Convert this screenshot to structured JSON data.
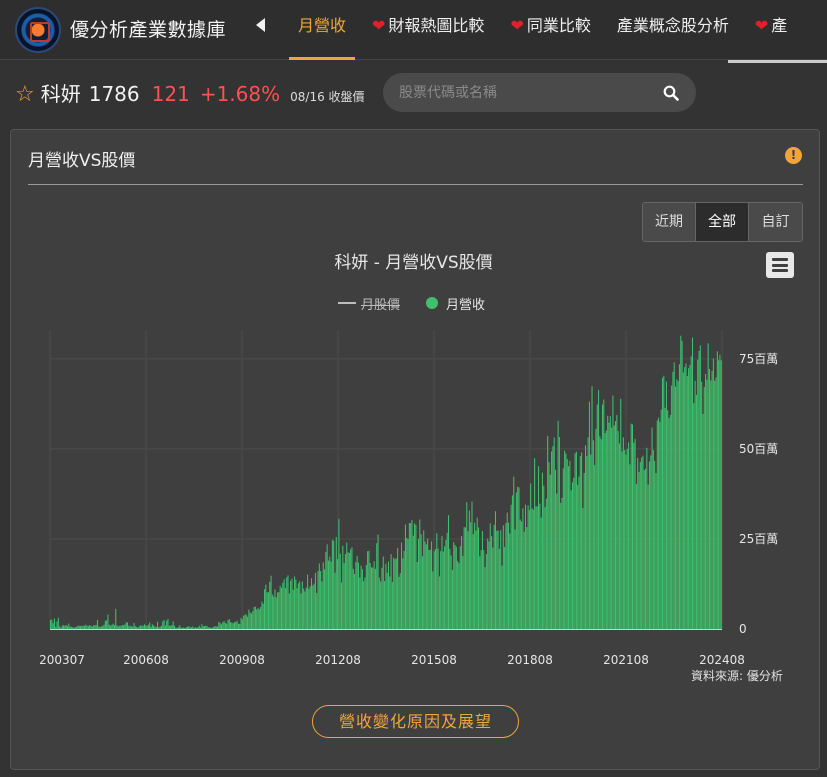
{
  "site": {
    "name": "優分析產業數據庫"
  },
  "nav": {
    "items": [
      {
        "label": "月營收",
        "heart": false,
        "active": true
      },
      {
        "label": "財報熱圖比較",
        "heart": true,
        "active": false
      },
      {
        "label": "同業比較",
        "heart": true,
        "active": false
      },
      {
        "label": "產業概念股分析",
        "heart": false,
        "active": false
      },
      {
        "label": "產",
        "heart": true,
        "active": false
      }
    ]
  },
  "quote": {
    "name": "科妍",
    "code": "1786",
    "price": "121",
    "change": "+1.68%",
    "date": "08/16 收盤價"
  },
  "search": {
    "placeholder": "股票代碼或名稱"
  },
  "card": {
    "title": "月營收VS股價"
  },
  "range": {
    "buttons": [
      "近期",
      "全部",
      "自訂"
    ],
    "selected": "全部"
  },
  "chart_data": {
    "type": "bar",
    "title": "科妍 - 月營收VS股價",
    "legend": [
      {
        "name": "月股價",
        "hidden": true
      },
      {
        "name": "月營收",
        "color": "#3ec06c"
      }
    ],
    "x_tick_labels": [
      "200307",
      "200608",
      "200908",
      "201208",
      "201508",
      "201808",
      "202108",
      "202408"
    ],
    "y_tick_labels": [
      "0",
      "25百萬",
      "50百萬",
      "75百萬"
    ],
    "ylim": [
      0,
      83
    ],
    "y_unit": "百萬",
    "x_start": "200307",
    "x_end": "202408",
    "values": [
      2.5,
      2.6,
      1.6,
      2.9,
      0.6,
      2.1,
      3.1,
      0.7,
      0.4,
      1.0,
      1.0,
      0.9,
      1.1,
      0.8,
      1.5,
      0.7,
      0.6,
      0.5,
      0.4,
      0.5,
      0.6,
      0.9,
      0.9,
      0.8,
      0.9,
      0.9,
      0.9,
      1.2,
      0.9,
      0.8,
      1.1,
      0.9,
      0.7,
      1.0,
      1.1,
      1.1,
      2.5,
      0.7,
      0.6,
      0.7,
      0.9,
      1.2,
      2.3,
      2.4,
      4.0,
      1.2,
      0.9,
      1.2,
      1.5,
      1.1,
      5.6,
      1.0,
      0.7,
      0.9,
      0.9,
      1.1,
      1.0,
      1.3,
      1.9,
      1.8,
      0.9,
      0.9,
      0.7,
      0.7,
      1.7,
      0.8,
      0.6,
      0.4,
      0.8,
      1.0,
      0.9,
      0.9,
      1.3,
      1.0,
      0.9,
      1.2,
      1.8,
      0.6,
      1.3,
      1.0,
      0.7,
      0.6,
      2.0,
      0.5,
      0.7,
      0.9,
      2.1,
      2.5,
      1.0,
      2.3,
      2.8,
      0.9,
      0.9,
      1.1,
      2.1,
      0.9,
      0.4,
      0.3,
      0.6,
      1.0,
      0.4,
      0.3,
      0.4,
      0.3,
      0.5,
      0.6,
      0.8,
      0.4,
      0.5,
      0.7,
      0.3,
      0.5,
      0.3,
      0.5,
      0.9,
      0.4,
      1.3,
      0.8,
      0.8,
      0.9,
      0.8,
      0.4,
      0.5,
      0.3,
      0.4,
      0.6,
      0.8,
      0.7,
      0.7,
      2.0,
      1.7,
      1.3,
      1.9,
      2.2,
      1.7,
      1.5,
      2.5,
      2.8,
      1.9,
      1.8,
      1.6,
      1.9,
      2.0,
      2.3,
      1.5,
      1.4,
      3.1,
      2.7,
      3.7,
      4.0,
      4.0,
      3.4,
      5.4,
      4.6,
      4.3,
      5.0,
      6.1,
      6.2,
      5.4,
      5.8,
      5.5,
      6.1,
      7.6,
      7.0,
      11.0,
      12.3,
      10.2,
      10.2,
      13.1,
      14.8,
      9.6,
      9.0,
      11.0,
      8.8,
      10.2,
      10.2,
      12.0,
      11.4,
      12.8,
      13.8,
      11.4,
      14.3,
      14.9,
      9.9,
      13.4,
      14.0,
      10.9,
      14.6,
      13.7,
      11.3,
      12.7,
      13.2,
      9.9,
      13.2,
      11.2,
      10.4,
      11.5,
      15.1,
      11.2,
      11.9,
      14.1,
      12.1,
      12.6,
      15.6,
      10.0,
      16.1,
      18.2,
      16.1,
      13.2,
      18.5,
      16.5,
      21.4,
      23.5,
      19.0,
      20.1,
      18.7,
      24.7,
      24.5,
      15.6,
      25.5,
      19.4,
      30.6,
      20.9,
      12.9,
      23.1,
      18.3,
      20.8,
      24.0,
      21.3,
      21.1,
      22.1,
      22.7,
      16.7,
      15.3,
      18.6,
      20.3,
      18.4,
      14.3,
      17.6,
      16.6,
      13.3,
      14.3,
      17.8,
      21.6,
      21.7,
      18.3,
      17.1,
      17.1,
      18.8,
      16.7,
      23.8,
      26.2,
      14.3,
      13.2,
      17.0,
      20.1,
      13.3,
      18.1,
      15.6,
      18.7,
      14.6,
      20.8,
      13.1,
      19.8,
      19.4,
      19.6,
      22.5,
      14.5,
      15.5,
      24.0,
      19.6,
      21.7,
      29.0,
      25.3,
      25.0,
      29.4,
      29.4,
      30.2,
      25.9,
      29.3,
      28.9,
      18.6,
      25.0,
      30.4,
      26.3,
      20.2,
      27.4,
      24.3,
      23.5,
      25.1,
      21.9,
      22.0,
      24.3,
      16.0,
      21.6,
      22.2,
      26.6,
      22.3,
      14.6,
      21.6,
      25.8,
      21.5,
      22.9,
      24.7,
      26.7,
      31.6,
      22.3,
      20.4,
      16.4,
      24.1,
      23.3,
      22.8,
      18.9,
      18.3,
      23.0,
      25.8,
      20.3,
      28.3,
      28.2,
      35.2,
      27.2,
      32.9,
      29.6,
      35.4,
      26.3,
      29.5,
      27.3,
      30.9,
      28.2,
      20.2,
      21.9,
      27.2,
      21.9,
      17.2,
      20.8,
      25.1,
      24.3,
      29.3,
      25.8,
      22.6,
      28.9,
      32.7,
      27.2,
      27.4,
      22.3,
      27.4,
      17.6,
      28.8,
      22.8,
      29.4,
      32.3,
      29.5,
      26.5,
      34.5,
      37.1,
      42.3,
      27.6,
      37.9,
      39.5,
      39.3,
      30.4,
      29.8,
      33.5,
      27.0,
      34.5,
      28.3,
      34.3,
      33.0,
      40.4,
      33.5,
      33.1,
      47.4,
      34.0,
      34.1,
      45.2,
      34.8,
      30.9,
      43.4,
      39.8,
      33.8,
      36.2,
      53.6,
      46.3,
      42.8,
      49.3,
      50.7,
      53.2,
      44.2,
      37.6,
      57.8,
      53.3,
      35.0,
      36.4,
      44.6,
      49.5,
      48.7,
      47.2,
      45.2,
      46.7,
      38.5,
      40.7,
      42.0,
      48.8,
      49.2,
      40.0,
      42.3,
      48.0,
      49.0,
      33.6,
      43.3,
      51.0,
      48.0,
      53.2,
      63.1,
      48.4,
      67.4,
      52.4,
      45.5,
      55.6,
      62.3,
      66.3,
      53.5,
      52.7,
      62.3,
      63.7,
      54.4,
      55.1,
      59.2,
      57.3,
      59.1,
      55.9,
      64.8,
      56.5,
      57.7,
      59.4,
      55.0,
      51.5,
      63.9,
      49.3,
      53.2,
      49.7,
      48.4,
      50.0,
      51.8,
      45.7,
      57.0,
      56.8,
      51.7,
      52.8,
      40.2,
      47.5,
      43.6,
      46.4,
      47.6,
      48.1,
      44.1,
      44.5,
      50.3,
      40.1,
      46.5,
      48.2,
      55.9,
      49.7,
      46.7,
      43.3,
      57.9,
      58.7,
      57.5,
      60.9,
      69.7,
      70.3,
      61.4,
      68.7,
      60.7,
      58.6,
      59.4,
      67.6,
      71.4,
      74.0,
      67.3,
      69.3,
      68.8,
      73.5,
      81.4,
      80.0,
      71.2,
      72.7,
      73.7,
      70.2,
      72.4,
      73.3,
      75.7,
      80.9,
      62.7,
      68.9,
      65.0,
      74.8,
      77.2,
      78.7,
      68.6,
      59.7,
      67.2,
      70.8,
      69.2,
      79.3,
      72.2,
      69.0,
      71.7,
      75.1,
      68.9,
      69.8,
      77.1,
      74.6,
      76.1,
      74.6
    ]
  },
  "source": "資料來源: 優分析",
  "reason_button": "營收變化原因及展望",
  "colors": {
    "accent": "#f0a637",
    "up": "#ff5050",
    "bar": "#3ec06c"
  }
}
